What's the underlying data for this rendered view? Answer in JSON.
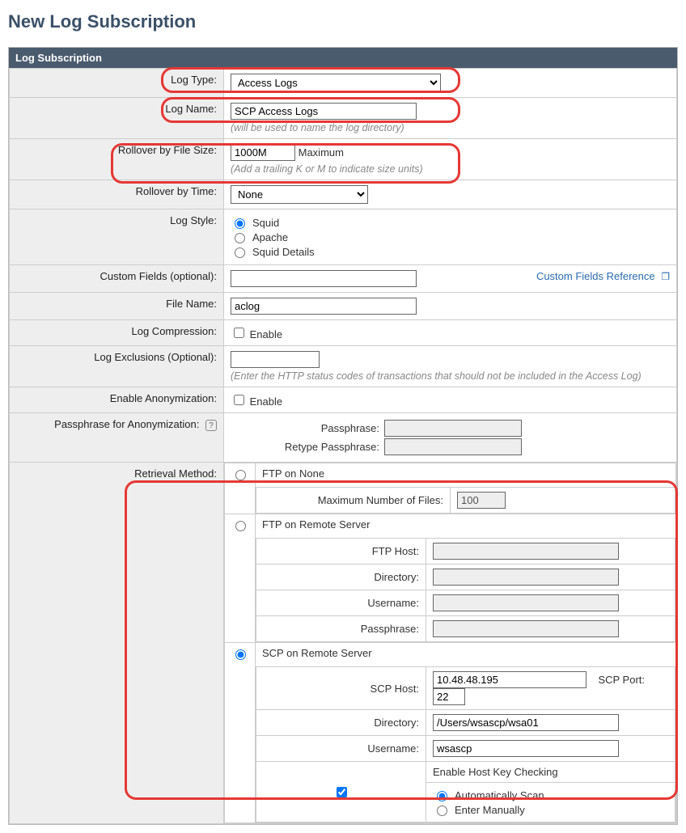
{
  "page": {
    "title": "New Log Subscription"
  },
  "panel": {
    "title": "Log Subscription"
  },
  "labels": {
    "log_type": "Log Type:",
    "log_name": "Log Name:",
    "log_name_hint": "(will be used to name the log directory)",
    "rollover_size": "Rollover by File Size:",
    "rollover_size_suffix": "Maximum",
    "rollover_size_hint": "(Add a trailing K or M to indicate size units)",
    "rollover_time": "Rollover by Time:",
    "log_style": "Log Style:",
    "custom_fields": "Custom Fields (optional):",
    "custom_fields_ref": "Custom Fields Reference",
    "file_name": "File Name:",
    "compression": "Log Compression:",
    "enable": "Enable",
    "exclusions": "Log Exclusions (Optional):",
    "exclusions_hint": "(Enter the HTTP status codes of transactions that should not be included in the Access Log)",
    "anonymization": "Enable Anonymization:",
    "anon_pass_section": "Passphrase for Anonymization:",
    "passphrase": "Passphrase:",
    "retype_passphrase": "Retype Passphrase:",
    "retrieval": "Retrieval Method:",
    "ftp_none": "FTP on None",
    "max_files": "Maximum Number of Files:",
    "ftp_remote": "FTP on Remote Server",
    "ftp_host": "FTP Host:",
    "directory": "Directory:",
    "username": "Username:",
    "ftp_pass": "Passphrase:",
    "scp_remote": "SCP on Remote Server",
    "scp_host": "SCP Host:",
    "scp_port": "SCP Port:",
    "enable_hostkey": "Enable Host Key Checking",
    "auto_scan": "Automatically Scan",
    "enter_manual": "Enter Manually"
  },
  "values": {
    "log_type": "Access Logs",
    "log_name": "SCP Access Logs",
    "rollover_size": "1000M",
    "rollover_time": "None",
    "log_style": {
      "squid": "Squid",
      "apache": "Apache",
      "squid_details": "Squid Details",
      "selected": "squid"
    },
    "custom_fields": "",
    "file_name": "aclog",
    "compression_enabled": false,
    "exclusions": "",
    "anonymization_enabled": false,
    "anon_pass": "",
    "anon_pass2": "",
    "retrieval_selected": "scp",
    "ftp_none": {
      "max_files": "100"
    },
    "ftp_remote": {
      "host": "",
      "directory": "",
      "username": "",
      "passphrase": ""
    },
    "scp": {
      "host": "10.48.48.195",
      "port": "22",
      "directory": "/Users/wsascp/wsa01",
      "username": "wsascp",
      "hostkey_enabled": true,
      "hostkey_mode": "auto"
    }
  }
}
